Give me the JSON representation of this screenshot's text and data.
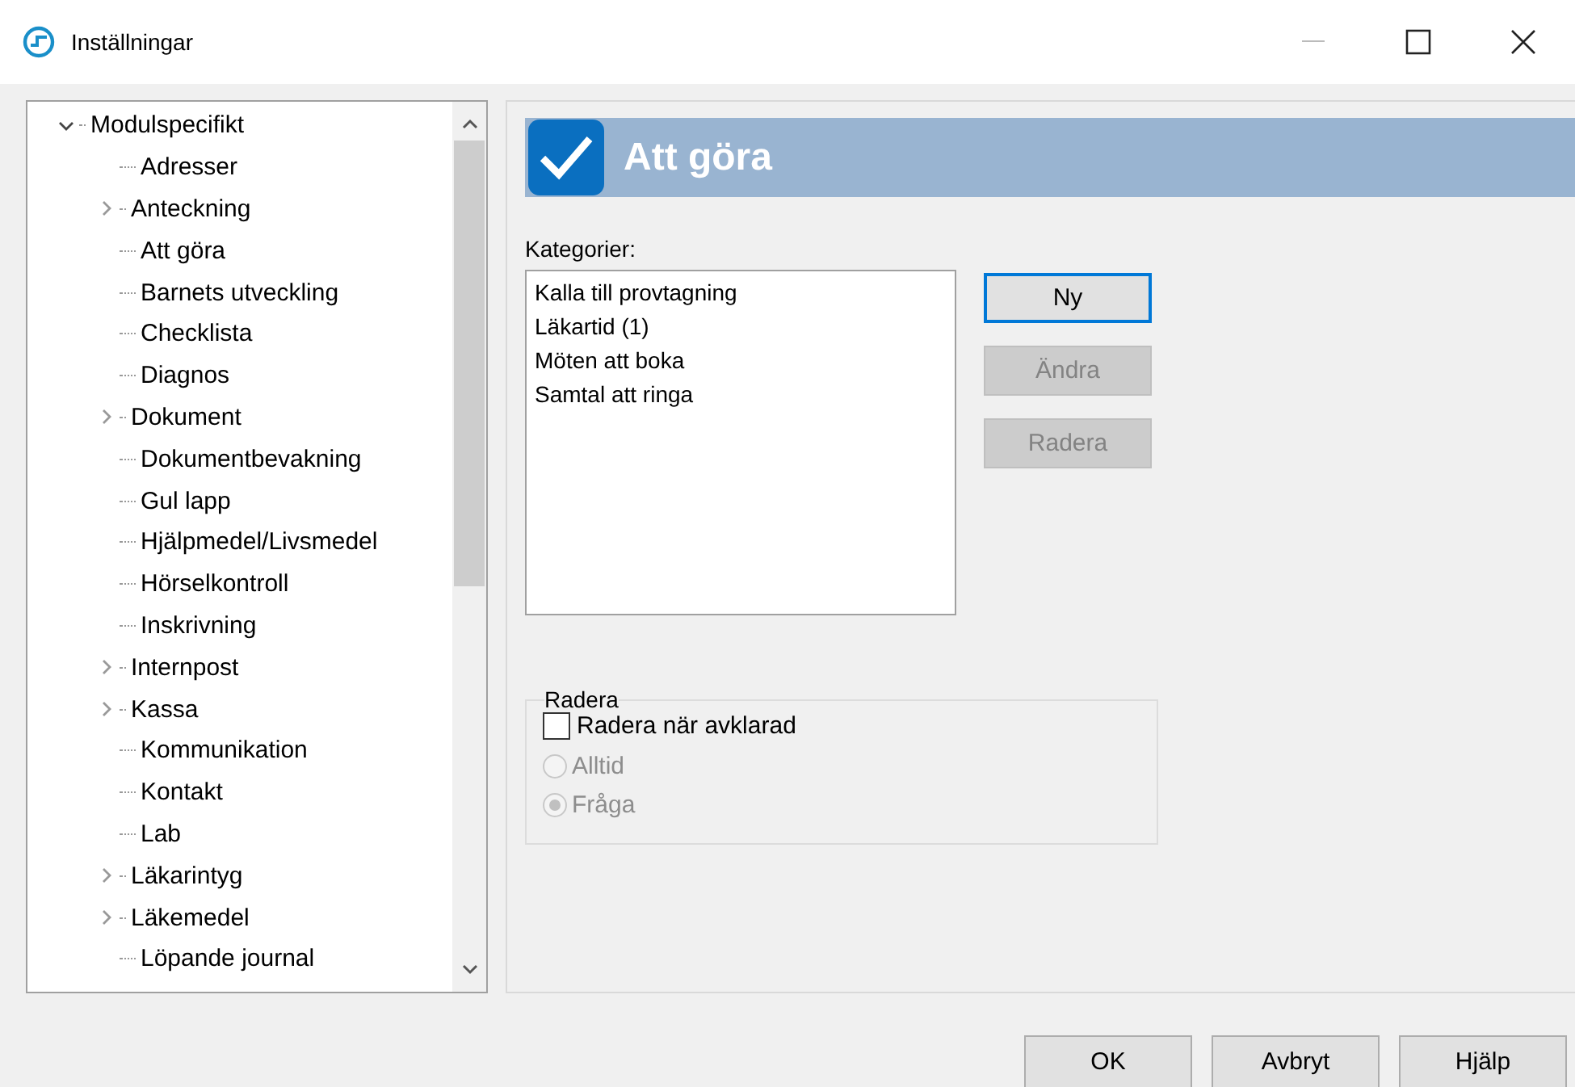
{
  "window": {
    "title": "Inställningar"
  },
  "tree": [
    {
      "label": "Modulspecifikt",
      "kind": "branch",
      "expanded": true,
      "children": [
        {
          "label": "Adresser",
          "kind": "leaf"
        },
        {
          "label": "Anteckning",
          "kind": "branch",
          "expanded": false
        },
        {
          "label": "Att göra",
          "kind": "leaf"
        },
        {
          "label": "Barnets utveckling",
          "kind": "leaf"
        },
        {
          "label": "Checklista",
          "kind": "leaf"
        },
        {
          "label": "Diagnos",
          "kind": "leaf"
        },
        {
          "label": "Dokument",
          "kind": "branch",
          "expanded": false
        },
        {
          "label": "Dokumentbevakning",
          "kind": "leaf"
        },
        {
          "label": "Gul lapp",
          "kind": "leaf"
        },
        {
          "label": "Hjälpmedel/Livsmedel",
          "kind": "leaf"
        },
        {
          "label": "Hörselkontroll",
          "kind": "leaf"
        },
        {
          "label": "Inskrivning",
          "kind": "leaf"
        },
        {
          "label": "Internpost",
          "kind": "branch",
          "expanded": false
        },
        {
          "label": "Kassa",
          "kind": "branch",
          "expanded": false
        },
        {
          "label": "Kommunikation",
          "kind": "leaf"
        },
        {
          "label": "Kontakt",
          "kind": "leaf"
        },
        {
          "label": "Lab",
          "kind": "leaf"
        },
        {
          "label": "Läkarintyg",
          "kind": "branch",
          "expanded": false
        },
        {
          "label": "Läkemedel",
          "kind": "branch",
          "expanded": false
        },
        {
          "label": "Löpande journal",
          "kind": "leaf"
        }
      ]
    }
  ],
  "panel": {
    "title": "Att göra",
    "categories_label": "Kategorier:",
    "categories": [
      {
        "label": "Kalla till provtagning",
        "selected": false
      },
      {
        "label": "Läkartid (1)",
        "selected": false
      },
      {
        "label": "Möten att boka",
        "selected": false
      },
      {
        "label": "Samtal att ringa",
        "selected": false
      }
    ],
    "side_buttons": [
      {
        "label": "Ny",
        "disabled": false,
        "focused": true
      },
      {
        "label": "Ändra",
        "disabled": true,
        "focused": false
      },
      {
        "label": "Radera",
        "disabled": true,
        "focused": false
      }
    ],
    "group": {
      "title": "Radera",
      "checkbox": {
        "label": "Radera när avklarad",
        "checked": false
      },
      "radios": [
        {
          "label": "Alltid",
          "selected": false,
          "disabled": true
        },
        {
          "label": "Fråga",
          "selected": true,
          "disabled": true
        }
      ]
    }
  },
  "buttons": [
    {
      "label": "OK"
    },
    {
      "label": "Avbryt"
    },
    {
      "label": "Hjälp"
    }
  ]
}
